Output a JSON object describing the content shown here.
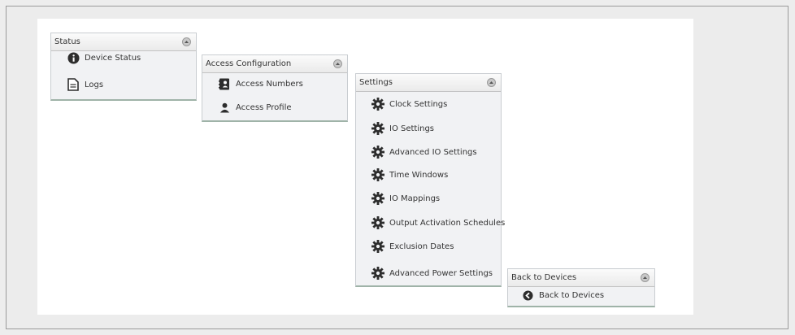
{
  "panels": {
    "status": {
      "title": "Status",
      "items": [
        {
          "label": "Device Status",
          "icon": "info-icon"
        },
        {
          "label": "Logs",
          "icon": "document-icon"
        }
      ]
    },
    "access": {
      "title": "Access Configuration",
      "items": [
        {
          "label": "Access Numbers",
          "icon": "address-book-icon"
        },
        {
          "label": "Access Profile",
          "icon": "person-icon"
        }
      ]
    },
    "settings": {
      "title": "Settings",
      "items": [
        {
          "label": "Clock Settings",
          "icon": "gear-icon"
        },
        {
          "label": "IO Settings",
          "icon": "gear-icon"
        },
        {
          "label": "Advanced IO Settings",
          "icon": "gear-icon"
        },
        {
          "label": "Time Windows",
          "icon": "gear-icon"
        },
        {
          "label": "IO Mappings",
          "icon": "gear-icon"
        },
        {
          "label": "Output Activation Schedules",
          "icon": "gear-icon"
        },
        {
          "label": "Exclusion Dates",
          "icon": "gear-icon"
        },
        {
          "label": "Advanced Power Settings",
          "icon": "gear-icon"
        }
      ]
    },
    "back": {
      "title": "Back to Devices",
      "items": [
        {
          "label": "Back to Devices",
          "icon": "back-arrow-icon"
        }
      ]
    }
  }
}
